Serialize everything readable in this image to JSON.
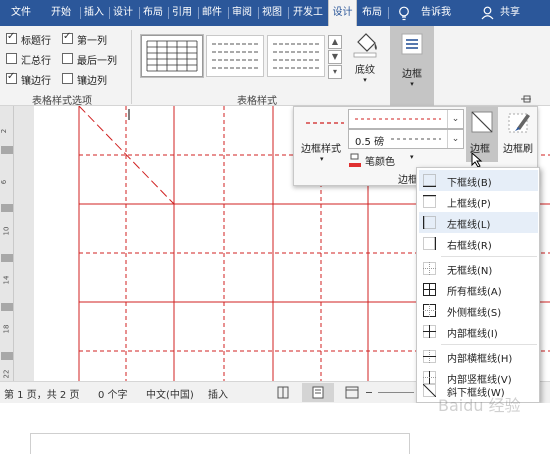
{
  "tabs": [
    {
      "label": "文件"
    },
    {
      "label": "开始"
    },
    {
      "label": "插入"
    },
    {
      "label": "设计"
    },
    {
      "label": "布局"
    },
    {
      "label": "引用"
    },
    {
      "label": "邮件"
    },
    {
      "label": "审阅"
    },
    {
      "label": "视图"
    },
    {
      "label": "开发工"
    },
    {
      "label": "设计"
    },
    {
      "label": "布局"
    }
  ],
  "tell_me": "告诉我",
  "share": "共享",
  "table_style_options": {
    "items": [
      {
        "label": "标题行",
        "checked": true
      },
      {
        "label": "第一列",
        "checked": true
      },
      {
        "label": "汇总行",
        "checked": false
      },
      {
        "label": "最后一列",
        "checked": false
      },
      {
        "label": "镶边行",
        "checked": true
      },
      {
        "label": "镶边列",
        "checked": false
      }
    ],
    "group_label": "表格样式选项"
  },
  "table_styles": {
    "group_label": "表格样式"
  },
  "shading_label": "底纹",
  "borders_label": "边框",
  "border_panel": {
    "border_styles_label": "边框样式",
    "weight": "0.5 磅",
    "pen_color": "笔颜色",
    "borders_btn": "边框",
    "border_painter": "边框刷",
    "group_label": "边框"
  },
  "ruler_numbers": [
    "2",
    "6",
    "10",
    "14",
    "18",
    "22"
  ],
  "status": {
    "page": "第 1 页，共 2 页",
    "words": "0 个字",
    "language": "中文(中国)",
    "mode": "插入"
  },
  "menu_items": [
    {
      "label": "下框线(B)",
      "icon": "bottom-border-icon"
    },
    {
      "label": "上框线(P)",
      "icon": "top-border-icon"
    },
    {
      "label": "左框线(L)",
      "icon": "left-border-icon"
    },
    {
      "label": "右框线(R)",
      "icon": "right-border-icon"
    },
    {
      "label": "无框线(N)",
      "icon": "no-border-icon"
    },
    {
      "label": "所有框线(A)",
      "icon": "all-borders-icon"
    },
    {
      "label": "外侧框线(S)",
      "icon": "outside-borders-icon"
    },
    {
      "label": "内部框线(I)",
      "icon": "inside-borders-icon"
    },
    {
      "label": "内部横框线(H)",
      "icon": "inside-horizontal-border-icon"
    },
    {
      "label": "内部竖框线(V)",
      "icon": "inside-vertical-border-icon"
    },
    {
      "label": "斜下框线(W)",
      "icon": "diagonal-down-border-icon"
    }
  ],
  "watermark": "Baidu 经验",
  "colors": {
    "ribbon_blue": "#2b579a",
    "table_red": "#d02020",
    "pen_color_red": "#e03030"
  }
}
